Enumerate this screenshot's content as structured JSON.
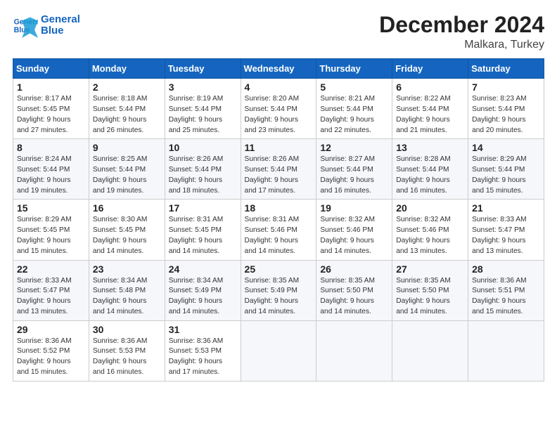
{
  "logo": {
    "line1": "General",
    "line2": "Blue"
  },
  "title": "December 2024",
  "subtitle": "Malkara, Turkey",
  "days_of_week": [
    "Sunday",
    "Monday",
    "Tuesday",
    "Wednesday",
    "Thursday",
    "Friday",
    "Saturday"
  ],
  "weeks": [
    [
      {
        "day": "1",
        "info": "Sunrise: 8:17 AM\nSunset: 5:45 PM\nDaylight: 9 hours\nand 27 minutes."
      },
      {
        "day": "2",
        "info": "Sunrise: 8:18 AM\nSunset: 5:44 PM\nDaylight: 9 hours\nand 26 minutes."
      },
      {
        "day": "3",
        "info": "Sunrise: 8:19 AM\nSunset: 5:44 PM\nDaylight: 9 hours\nand 25 minutes."
      },
      {
        "day": "4",
        "info": "Sunrise: 8:20 AM\nSunset: 5:44 PM\nDaylight: 9 hours\nand 23 minutes."
      },
      {
        "day": "5",
        "info": "Sunrise: 8:21 AM\nSunset: 5:44 PM\nDaylight: 9 hours\nand 22 minutes."
      },
      {
        "day": "6",
        "info": "Sunrise: 8:22 AM\nSunset: 5:44 PM\nDaylight: 9 hours\nand 21 minutes."
      },
      {
        "day": "7",
        "info": "Sunrise: 8:23 AM\nSunset: 5:44 PM\nDaylight: 9 hours\nand 20 minutes."
      }
    ],
    [
      {
        "day": "8",
        "info": "Sunrise: 8:24 AM\nSunset: 5:44 PM\nDaylight: 9 hours\nand 19 minutes."
      },
      {
        "day": "9",
        "info": "Sunrise: 8:25 AM\nSunset: 5:44 PM\nDaylight: 9 hours\nand 19 minutes."
      },
      {
        "day": "10",
        "info": "Sunrise: 8:26 AM\nSunset: 5:44 PM\nDaylight: 9 hours\nand 18 minutes."
      },
      {
        "day": "11",
        "info": "Sunrise: 8:26 AM\nSunset: 5:44 PM\nDaylight: 9 hours\nand 17 minutes."
      },
      {
        "day": "12",
        "info": "Sunrise: 8:27 AM\nSunset: 5:44 PM\nDaylight: 9 hours\nand 16 minutes."
      },
      {
        "day": "13",
        "info": "Sunrise: 8:28 AM\nSunset: 5:44 PM\nDaylight: 9 hours\nand 16 minutes."
      },
      {
        "day": "14",
        "info": "Sunrise: 8:29 AM\nSunset: 5:44 PM\nDaylight: 9 hours\nand 15 minutes."
      }
    ],
    [
      {
        "day": "15",
        "info": "Sunrise: 8:29 AM\nSunset: 5:45 PM\nDaylight: 9 hours\nand 15 minutes."
      },
      {
        "day": "16",
        "info": "Sunrise: 8:30 AM\nSunset: 5:45 PM\nDaylight: 9 hours\nand 14 minutes."
      },
      {
        "day": "17",
        "info": "Sunrise: 8:31 AM\nSunset: 5:45 PM\nDaylight: 9 hours\nand 14 minutes."
      },
      {
        "day": "18",
        "info": "Sunrise: 8:31 AM\nSunset: 5:46 PM\nDaylight: 9 hours\nand 14 minutes."
      },
      {
        "day": "19",
        "info": "Sunrise: 8:32 AM\nSunset: 5:46 PM\nDaylight: 9 hours\nand 14 minutes."
      },
      {
        "day": "20",
        "info": "Sunrise: 8:32 AM\nSunset: 5:46 PM\nDaylight: 9 hours\nand 13 minutes."
      },
      {
        "day": "21",
        "info": "Sunrise: 8:33 AM\nSunset: 5:47 PM\nDaylight: 9 hours\nand 13 minutes."
      }
    ],
    [
      {
        "day": "22",
        "info": "Sunrise: 8:33 AM\nSunset: 5:47 PM\nDaylight: 9 hours\nand 13 minutes."
      },
      {
        "day": "23",
        "info": "Sunrise: 8:34 AM\nSunset: 5:48 PM\nDaylight: 9 hours\nand 14 minutes."
      },
      {
        "day": "24",
        "info": "Sunrise: 8:34 AM\nSunset: 5:49 PM\nDaylight: 9 hours\nand 14 minutes."
      },
      {
        "day": "25",
        "info": "Sunrise: 8:35 AM\nSunset: 5:49 PM\nDaylight: 9 hours\nand 14 minutes."
      },
      {
        "day": "26",
        "info": "Sunrise: 8:35 AM\nSunset: 5:50 PM\nDaylight: 9 hours\nand 14 minutes."
      },
      {
        "day": "27",
        "info": "Sunrise: 8:35 AM\nSunset: 5:50 PM\nDaylight: 9 hours\nand 14 minutes."
      },
      {
        "day": "28",
        "info": "Sunrise: 8:36 AM\nSunset: 5:51 PM\nDaylight: 9 hours\nand 15 minutes."
      }
    ],
    [
      {
        "day": "29",
        "info": "Sunrise: 8:36 AM\nSunset: 5:52 PM\nDaylight: 9 hours\nand 15 minutes."
      },
      {
        "day": "30",
        "info": "Sunrise: 8:36 AM\nSunset: 5:53 PM\nDaylight: 9 hours\nand 16 minutes."
      },
      {
        "day": "31",
        "info": "Sunrise: 8:36 AM\nSunset: 5:53 PM\nDaylight: 9 hours\nand 17 minutes."
      },
      null,
      null,
      null,
      null
    ]
  ]
}
